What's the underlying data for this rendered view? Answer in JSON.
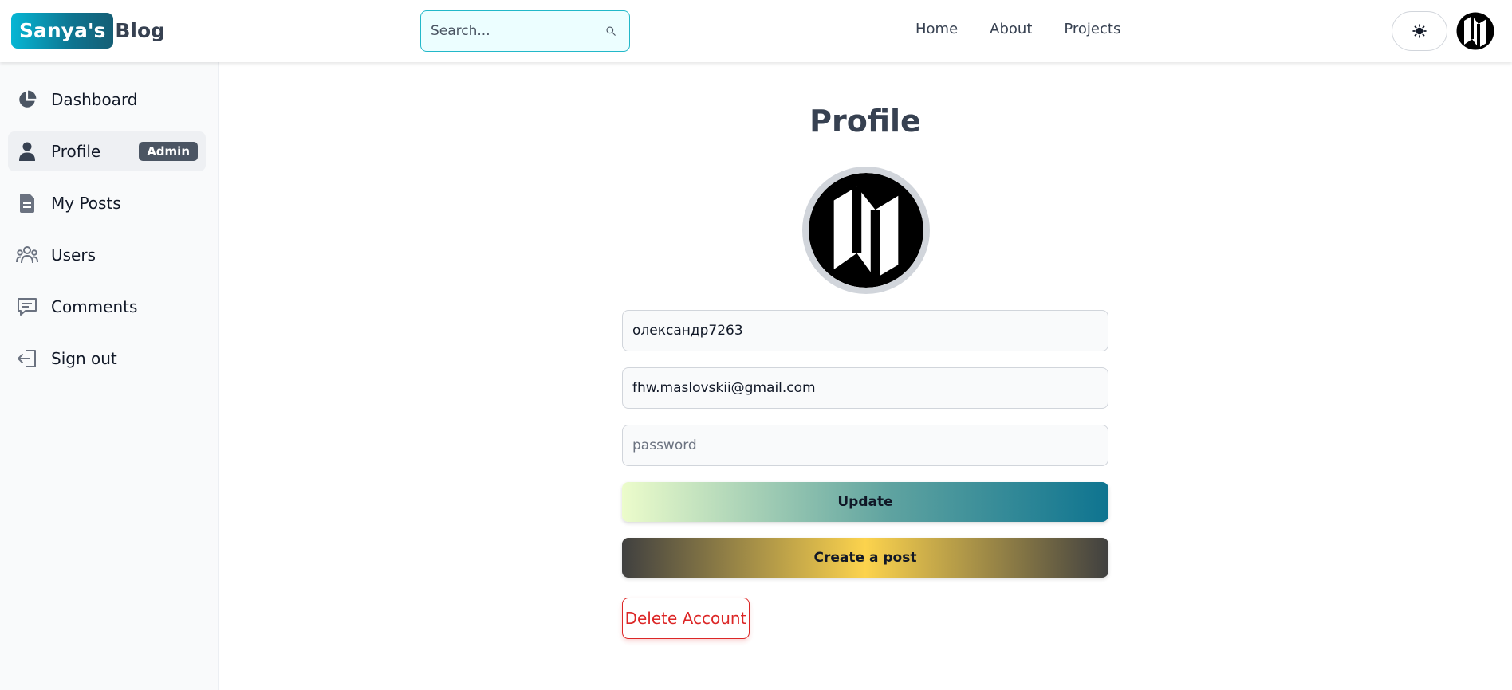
{
  "header": {
    "logo_pill": "Sanya's",
    "logo_text": "Blog",
    "search": {
      "placeholder": "Search...",
      "icon": "search-icon"
    },
    "nav": {
      "home": "Home",
      "about": "About",
      "projects": "Projects"
    },
    "theme_toggle_icon": "sun-icon",
    "avatar_icon": "map-logo-icon"
  },
  "sidebar": {
    "items": [
      {
        "label": "Dashboard",
        "icon": "pie-chart-icon"
      },
      {
        "label": "Profile",
        "icon": "user-icon",
        "badge": "Admin",
        "active": true
      },
      {
        "label": "My Posts",
        "icon": "document-icon"
      },
      {
        "label": "Users",
        "icon": "users-icon"
      },
      {
        "label": "Comments",
        "icon": "comment-icon"
      },
      {
        "label": "Sign out",
        "icon": "sign-out-icon"
      }
    ]
  },
  "main": {
    "title": "Profile",
    "avatar_icon": "map-logo-icon",
    "username": "олександр7263",
    "email": "fhw.maslovskii@gmail.com",
    "password_placeholder": "password",
    "update_label": "Update",
    "create_post_label": "Create a post",
    "delete_label": "Delete Account"
  },
  "colors": {
    "brand_cyan": "#06b6d4",
    "brand_teal": "#0e7490",
    "danger": "#dc2626",
    "sidebar_bg": "#f9fafb",
    "badge_bg": "#4b5563"
  }
}
